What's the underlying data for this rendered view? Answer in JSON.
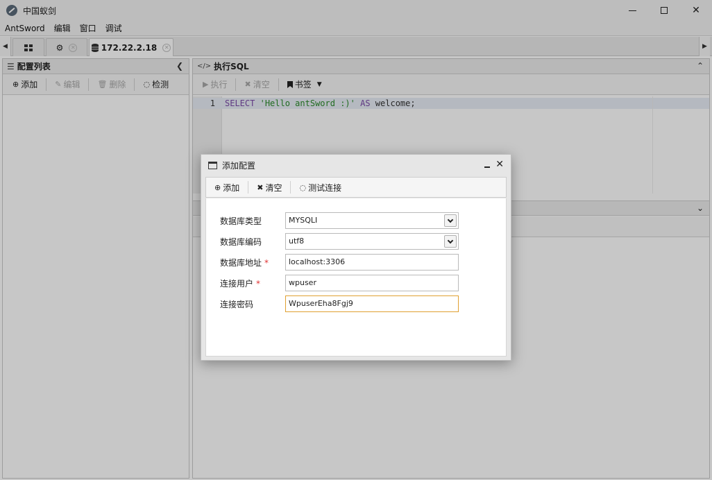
{
  "window": {
    "title": "中国蚁剑"
  },
  "menu": [
    "AntSword",
    "编辑",
    "窗口",
    "调试"
  ],
  "tabs": {
    "active_label": "172.22.2.18"
  },
  "left_panel": {
    "title": "配置列表",
    "toolbar": {
      "add": "添加",
      "edit": "编辑",
      "delete": "删除",
      "check": "检测"
    }
  },
  "right_panel": {
    "title": "执行SQL",
    "toolbar": {
      "execute": "执行",
      "clear": "清空",
      "bookmark": "书签"
    },
    "editor": {
      "line_number": "1",
      "tokens": {
        "select": "SELECT",
        "string": "'Hello antSword :)'",
        "as": "AS",
        "alias": "welcome;"
      }
    }
  },
  "dialog": {
    "title": "添加配置",
    "toolbar": {
      "add": "添加",
      "clear": "清空",
      "test": "测试连接"
    },
    "fields": {
      "db_type": {
        "label": "数据库类型",
        "value": "MYSQLI"
      },
      "db_encoding": {
        "label": "数据库编码",
        "value": "utf8"
      },
      "db_address": {
        "label": "数据库地址",
        "value": "localhost:3306",
        "required_mark": "*"
      },
      "db_user": {
        "label": "连接用户",
        "value": "wpuser",
        "required_mark": "*"
      },
      "db_password": {
        "label": "连接密码",
        "value": "WpuserEha8Fgj9"
      }
    }
  },
  "colors": {
    "required": "#e03333",
    "focus_border": "#e0a030",
    "keyword": "#7b49a8",
    "string": "#2a8a2a"
  }
}
